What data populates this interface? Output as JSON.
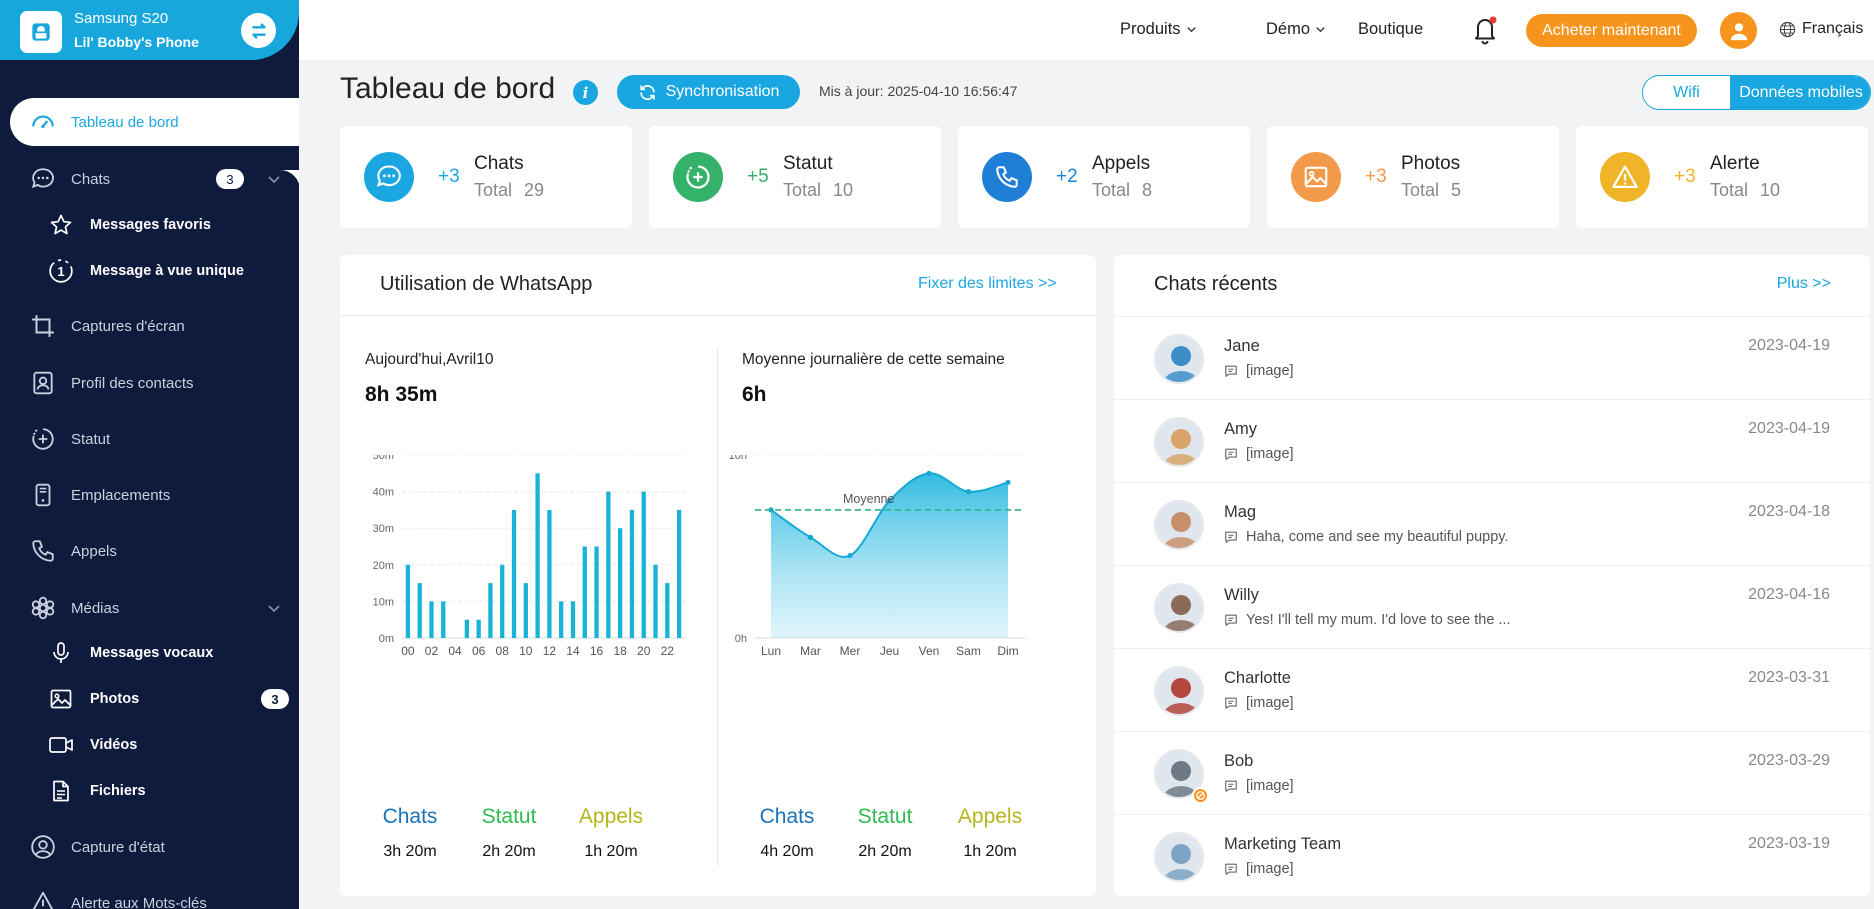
{
  "device": {
    "name": "Samsung S20",
    "phone": "Lil' Bobby's Phone"
  },
  "sidebar": {
    "items": [
      {
        "label": "Tableau de bord",
        "icon": "dashboard-icon"
      },
      {
        "label": "Chats",
        "icon": "chat-icon",
        "badge": "3"
      },
      {
        "label": "Messages favoris",
        "icon": "star-icon"
      },
      {
        "label": "Message à vue unique",
        "icon": "view-once-icon"
      },
      {
        "label": "Captures d'écran",
        "icon": "crop-icon"
      },
      {
        "label": "Profil des contacts",
        "icon": "contact-icon"
      },
      {
        "label": "Statut",
        "icon": "status-icon"
      },
      {
        "label": "Emplacements",
        "icon": "location-icon"
      },
      {
        "label": "Appels",
        "icon": "phone-icon"
      },
      {
        "label": "Médias",
        "icon": "media-icon"
      },
      {
        "label": "Messages vocaux",
        "icon": "mic-icon"
      },
      {
        "label": "Photos",
        "icon": "image-icon",
        "badge": "3"
      },
      {
        "label": "Vidéos",
        "icon": "video-icon"
      },
      {
        "label": "Fichiers",
        "icon": "file-icon"
      },
      {
        "label": "Capture d'état",
        "icon": "capture-icon"
      },
      {
        "label": "Alerte aux Mots-clés",
        "icon": "alert-icon"
      }
    ]
  },
  "topbar": {
    "products": "Produits",
    "demo": "Démo",
    "shop": "Boutique",
    "buy": "Acheter maintenant",
    "language": "Français"
  },
  "header": {
    "title": "Tableau de bord",
    "sync": "Synchronisation",
    "updated": "Mis à jour: 2025-04-10 16:56:47",
    "wifi": "Wifi",
    "mobile": "Données mobiles"
  },
  "stats": [
    {
      "delta": "+3",
      "name": "Chats",
      "total_label": "Total",
      "total": "29",
      "color": "#1aa6e0",
      "icon": "chat-bubble-icon"
    },
    {
      "delta": "+5",
      "name": "Statut",
      "total_label": "Total",
      "total": "10",
      "color": "#34b26a",
      "icon": "status-icon"
    },
    {
      "delta": "+2",
      "name": "Appels",
      "total_label": "Total",
      "total": "8",
      "color": "#1f7fd6",
      "icon": "phone-icon"
    },
    {
      "delta": "+3",
      "name": "Photos",
      "total_label": "Total",
      "total": "5",
      "color": "#f29a4a",
      "icon": "image-icon"
    },
    {
      "delta": "+3",
      "name": "Alerte",
      "total_label": "Total",
      "total": "10",
      "color": "#f0b429",
      "icon": "warning-icon"
    }
  ],
  "usage": {
    "title": "Utilisation de WhatsApp",
    "limits_link": "Fixer des limites >>",
    "today": {
      "label": "Aujourd'hui,Avril10",
      "value": "8h 35m",
      "legend": [
        {
          "name": "Chats",
          "value": "3h 20m",
          "color": "#1a73b8"
        },
        {
          "name": "Statut",
          "value": "2h 20m",
          "color": "#2dbb4e"
        },
        {
          "name": "Appels",
          "value": "1h 20m",
          "color": "#b5b51d"
        }
      ]
    },
    "week": {
      "label": "Moyenne journalière de cette semaine",
      "value": "6h",
      "legend": [
        {
          "name": "Chats",
          "value": "4h 20m",
          "color": "#1a73b8"
        },
        {
          "name": "Statut",
          "value": "2h 20m",
          "color": "#2dbb4e"
        },
        {
          "name": "Appels",
          "value": "1h 20m",
          "color": "#b5b51d"
        }
      ]
    }
  },
  "chart_data": [
    {
      "type": "bar",
      "categories": [
        "00",
        "01",
        "02",
        "03",
        "04",
        "05",
        "06",
        "07",
        "08",
        "09",
        "10",
        "11",
        "12",
        "13",
        "14",
        "15",
        "16",
        "17",
        "18",
        "19",
        "20",
        "21",
        "22",
        "23"
      ],
      "tick_labels": [
        "00",
        "02",
        "04",
        "06",
        "08",
        "10",
        "12",
        "14",
        "16",
        "18",
        "20",
        "22"
      ],
      "values": [
        20,
        15,
        10,
        10,
        0,
        5,
        5,
        15,
        20,
        35,
        15,
        45,
        35,
        10,
        10,
        25,
        25,
        40,
        30,
        35,
        40,
        20,
        15,
        35
      ],
      "y_ticks": [
        "0m",
        "10m",
        "20m",
        "30m",
        "40m",
        "50m"
      ],
      "ylim": [
        0,
        50
      ],
      "color": "#17b3d8",
      "grid": true
    },
    {
      "type": "area",
      "categories": [
        "Lun",
        "Mar",
        "Mer",
        "Jeu",
        "Ven",
        "Sam",
        "Dim"
      ],
      "values": [
        7,
        5.5,
        4.5,
        7.5,
        9,
        8,
        8.5
      ],
      "average": 7,
      "average_label": "Moyenne",
      "y_ticks": [
        "0h",
        "10h"
      ],
      "ylim": [
        0,
        10
      ],
      "color": "#17b3d8",
      "grid": true
    }
  ],
  "recent": {
    "title": "Chats récents",
    "more": "Plus >>",
    "items": [
      {
        "name": "Jane",
        "msg": "[image]",
        "date": "2023-04-19",
        "color": "#3a8fc7"
      },
      {
        "name": "Amy",
        "msg": "[image]",
        "date": "2023-04-19",
        "color": "#d9a46a"
      },
      {
        "name": "Mag",
        "msg": "Haha, come and see my beautiful puppy.",
        "date": "2023-04-18",
        "color": "#c98f6b"
      },
      {
        "name": "Willy",
        "msg": "Yes! I'll tell my mum. I'd love to see the ...",
        "date": "2023-04-16",
        "color": "#8b6a5a"
      },
      {
        "name": "Charlotte",
        "msg": "[image]",
        "date": "2023-03-31",
        "color": "#b3473c"
      },
      {
        "name": "Bob",
        "msg": "[image]",
        "date": "2023-03-29",
        "color": "#6d7a86"
      },
      {
        "name": "Marketing Team",
        "msg": "[image]",
        "date": "2023-03-19",
        "color": "#7fa3c4"
      }
    ]
  }
}
